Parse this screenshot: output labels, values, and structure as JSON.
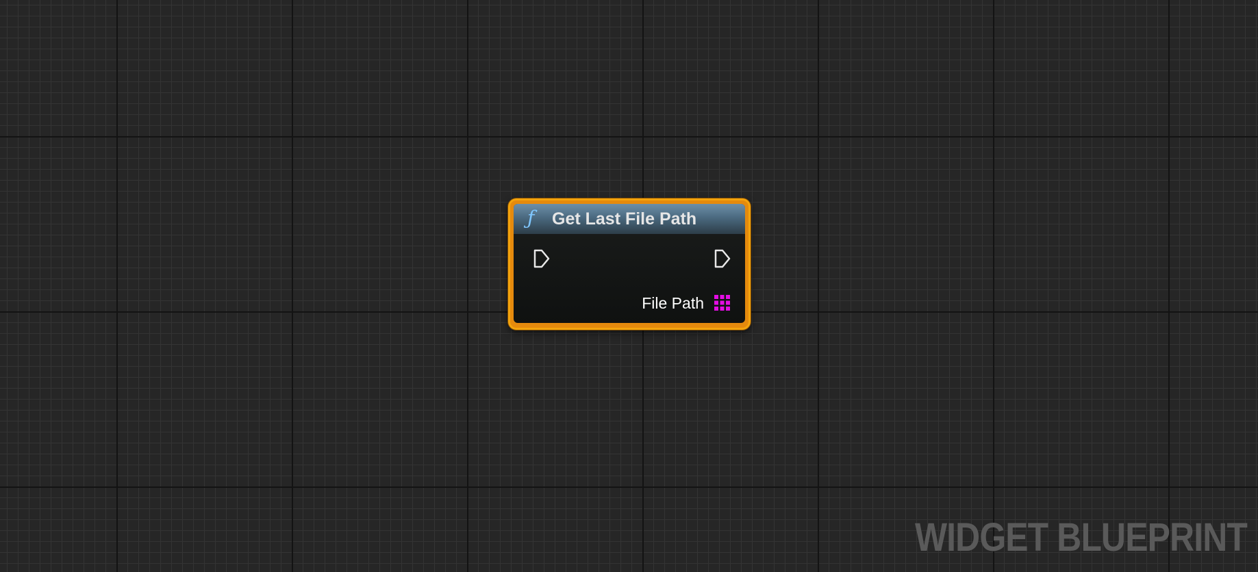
{
  "graph": {
    "node": {
      "icon": "function-icon",
      "icon_glyph": "ƒ",
      "title": "Get Last File Path",
      "exec_in_icon": "exec-pin-icon",
      "exec_out_icon": "exec-pin-icon",
      "output_pin": {
        "label": "File Path",
        "icon": "map-pin-icon",
        "color": "#e40de4"
      },
      "border_color": "#f3a30d",
      "header_color": "#4b6a80"
    },
    "watermark": "WIDGET BLUEPRINT"
  }
}
